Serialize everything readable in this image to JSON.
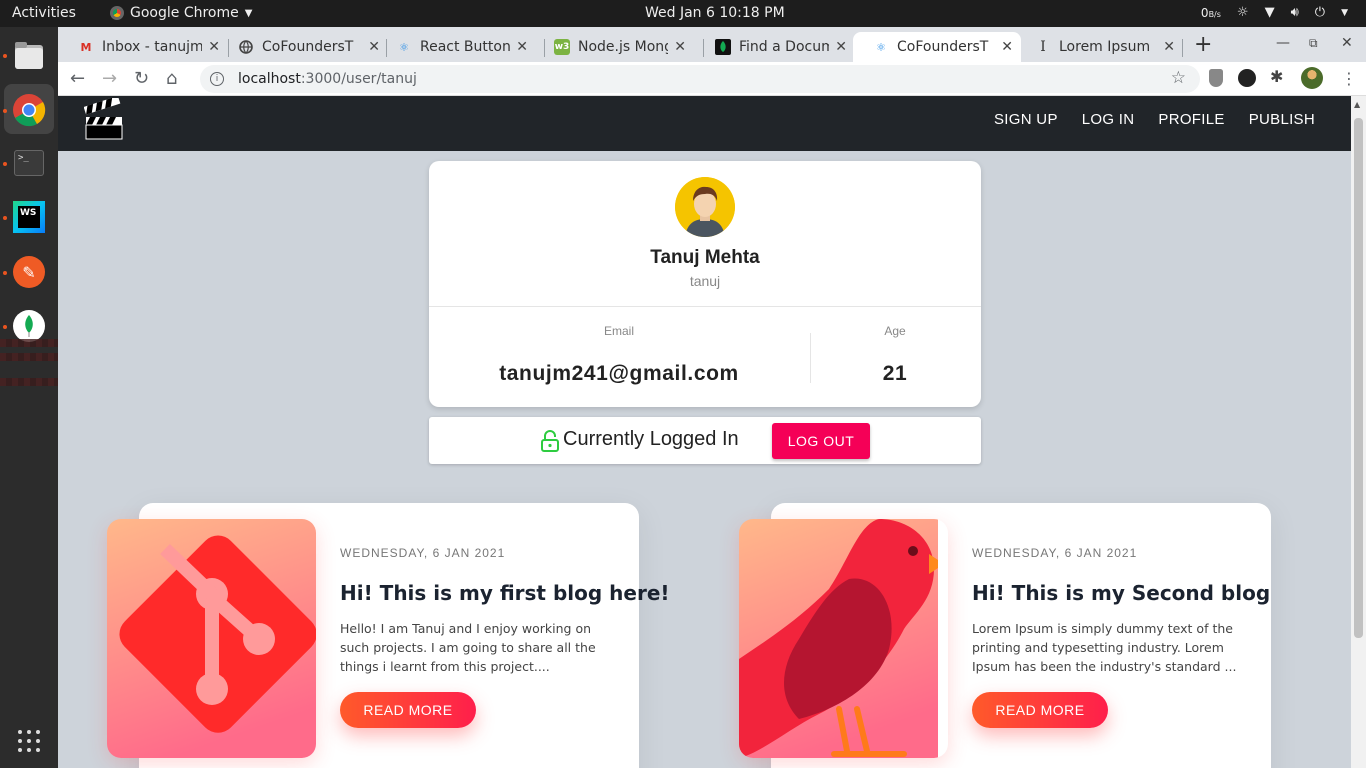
{
  "os": {
    "activities_label": "Activities",
    "app_name": "Google Chrome",
    "clock": "Wed Jan 6  10:18 PM",
    "net_speed": "0",
    "net_unit": "B/s"
  },
  "browser": {
    "tabs": [
      {
        "title": "Inbox - tanujm",
        "icon": "gmail-icon"
      },
      {
        "title": "CoFoundersT",
        "icon": "globe-icon"
      },
      {
        "title": "React Button",
        "icon": "react-icon"
      },
      {
        "title": "Node.js Mong",
        "icon": "mongo-icon"
      },
      {
        "title": "Find a Docum",
        "icon": "mongodb-leaf-icon"
      },
      {
        "title": "CoFoundersT",
        "icon": "react-icon",
        "active": true
      },
      {
        "title": "Lorem Ipsum",
        "icon": "lipsum-icon"
      }
    ],
    "url_host": "localhost",
    "url_path": ":3000/user/tanuj"
  },
  "site": {
    "nav": [
      "SIGN UP",
      "LOG IN",
      "PROFILE",
      "PUBLISH"
    ]
  },
  "profile": {
    "name": "Tanuj Mehta",
    "username": "tanuj",
    "email_label": "Email",
    "email": "tanujm241@gmail.com",
    "age_label": "Age",
    "age": "21"
  },
  "login": {
    "status": "Currently Logged In",
    "logout_label": "LOG OUT",
    "accent": "#f50057"
  },
  "blogs": [
    {
      "date": "WEDNESDAY, 6 JAN 2021",
      "title": "Hi! This is my first blog here!",
      "excerpt": "Hello! I am Tanuj and I enjoy working on such projects. I am going to share all the things i learnt from this project....",
      "button": "READ MORE",
      "image": "git-logo"
    },
    {
      "date": "WEDNESDAY, 6 JAN 2021",
      "title": "Hi! This is my Second blog",
      "excerpt": "Lorem Ipsum is simply dummy text of the printing and typesetting industry. Lorem Ipsum has been the industry's standard ...",
      "button": "READ MORE",
      "image": "red-bird"
    }
  ]
}
